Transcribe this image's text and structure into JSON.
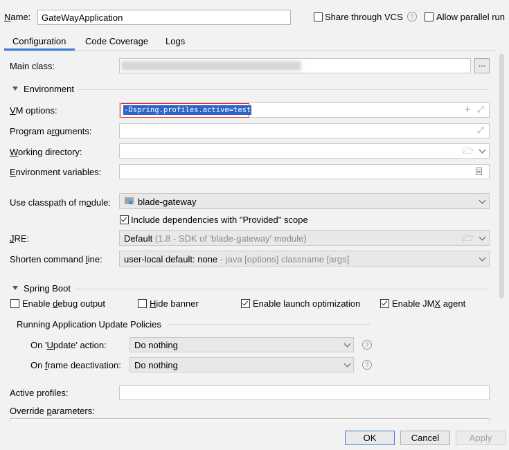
{
  "header": {
    "name_label": "Name:",
    "name_value": "GateWayApplication",
    "share_vcs": "Share through VCS",
    "share_vcs_checked": false,
    "allow_parallel": "Allow parallel run",
    "allow_parallel_checked": false,
    "help_glyph": "?"
  },
  "tabs": [
    {
      "label": "Configuration",
      "active": true
    },
    {
      "label": "Code Coverage",
      "active": false
    },
    {
      "label": "Logs",
      "active": false
    }
  ],
  "main_class": {
    "label": "Main class:",
    "value": "",
    "browse_label": "..."
  },
  "environment": {
    "section_label": "Environment",
    "vm_options": {
      "label": "VM options:",
      "value": "-Dspring.profiles.active=test"
    },
    "program_arguments": {
      "label": "Program arguments:",
      "value": ""
    },
    "working_directory": {
      "label": "Working directory:",
      "value": ""
    },
    "environment_variables": {
      "label": "Environment variables:",
      "value": ""
    }
  },
  "classpath": {
    "label": "Use classpath of module:",
    "value": "blade-gateway",
    "include_provided": "Include dependencies with \"Provided\" scope",
    "include_provided_checked": true
  },
  "jre": {
    "label": "JRE:",
    "value": "Default",
    "hint": "(1.8 - SDK of 'blade-gateway' module)"
  },
  "shorten": {
    "label": "Shorten command line:",
    "value": "user-local default: none",
    "hint": "- java [options] classname [args]"
  },
  "spring_boot": {
    "section_label": "Spring Boot",
    "options": [
      {
        "label": "Enable debug output",
        "checked": false
      },
      {
        "label": "Hide banner",
        "checked": false
      },
      {
        "label": "Enable launch optimization",
        "checked": true
      },
      {
        "label": "Enable JMX agent",
        "checked": true
      }
    ],
    "update_policies": {
      "section_label": "Running Application Update Policies",
      "on_update": {
        "label": "On 'Update' action:",
        "value": "Do nothing"
      },
      "on_frame": {
        "label": "On frame deactivation:",
        "value": "Do nothing"
      }
    }
  },
  "active_profiles": {
    "label": "Active profiles:",
    "value": ""
  },
  "override_parameters": {
    "label": "Override parameters:"
  },
  "buttons": {
    "ok": "OK",
    "cancel": "Cancel",
    "apply": "Apply"
  },
  "colors": {
    "accent": "#3d7edb",
    "selection": "#2f65ca",
    "highlight_box": "#e0312f"
  }
}
